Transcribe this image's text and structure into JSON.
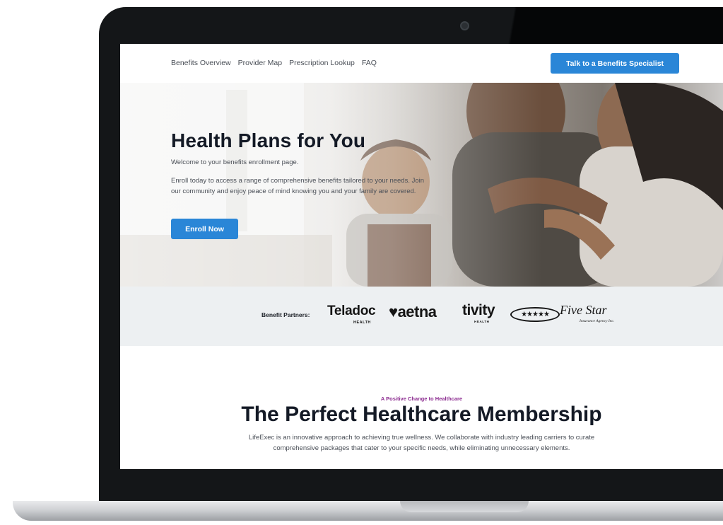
{
  "nav": {
    "links": [
      "Benefits Overview",
      "Provider Map",
      "Prescription Lookup",
      "FAQ"
    ],
    "cta_label": "Talk to a Benefits Specialist"
  },
  "hero": {
    "title": "Health Plans for You",
    "welcome": "Welcome to your benefits enrollment page.",
    "description": "Enroll today to access a range of comprehensive benefits tailored to your needs. Join our community and enjoy peace of mind knowing you and your family are covered.",
    "button_label": "Enroll Now"
  },
  "partners": {
    "label": "Benefit Partners:",
    "logos": {
      "teladoc": "Teladoc",
      "teladoc_sub": "HEALTH",
      "aetna": "♥aetna",
      "tivity": "tivity",
      "tivity_sub": "HEALTH",
      "fivestar_stars": "★★★★★",
      "fivestar": "Five Star",
      "fivestar_sub": "Insurance Agency Inc."
    }
  },
  "membership": {
    "eyebrow": "A Positive Change to Healthcare",
    "title": "The Perfect Healthcare Membership",
    "description": "LifeExec is an innovative approach to achieving true wellness. We collaborate with industry leading carriers to curate comprehensive packages that cater to your specific needs, while eliminating unnecessary elements."
  },
  "colors": {
    "accent": "#2a86d7",
    "heading": "#141a26",
    "eyebrow": "#8b2a8f",
    "partners_bg": "#edf0f2"
  }
}
